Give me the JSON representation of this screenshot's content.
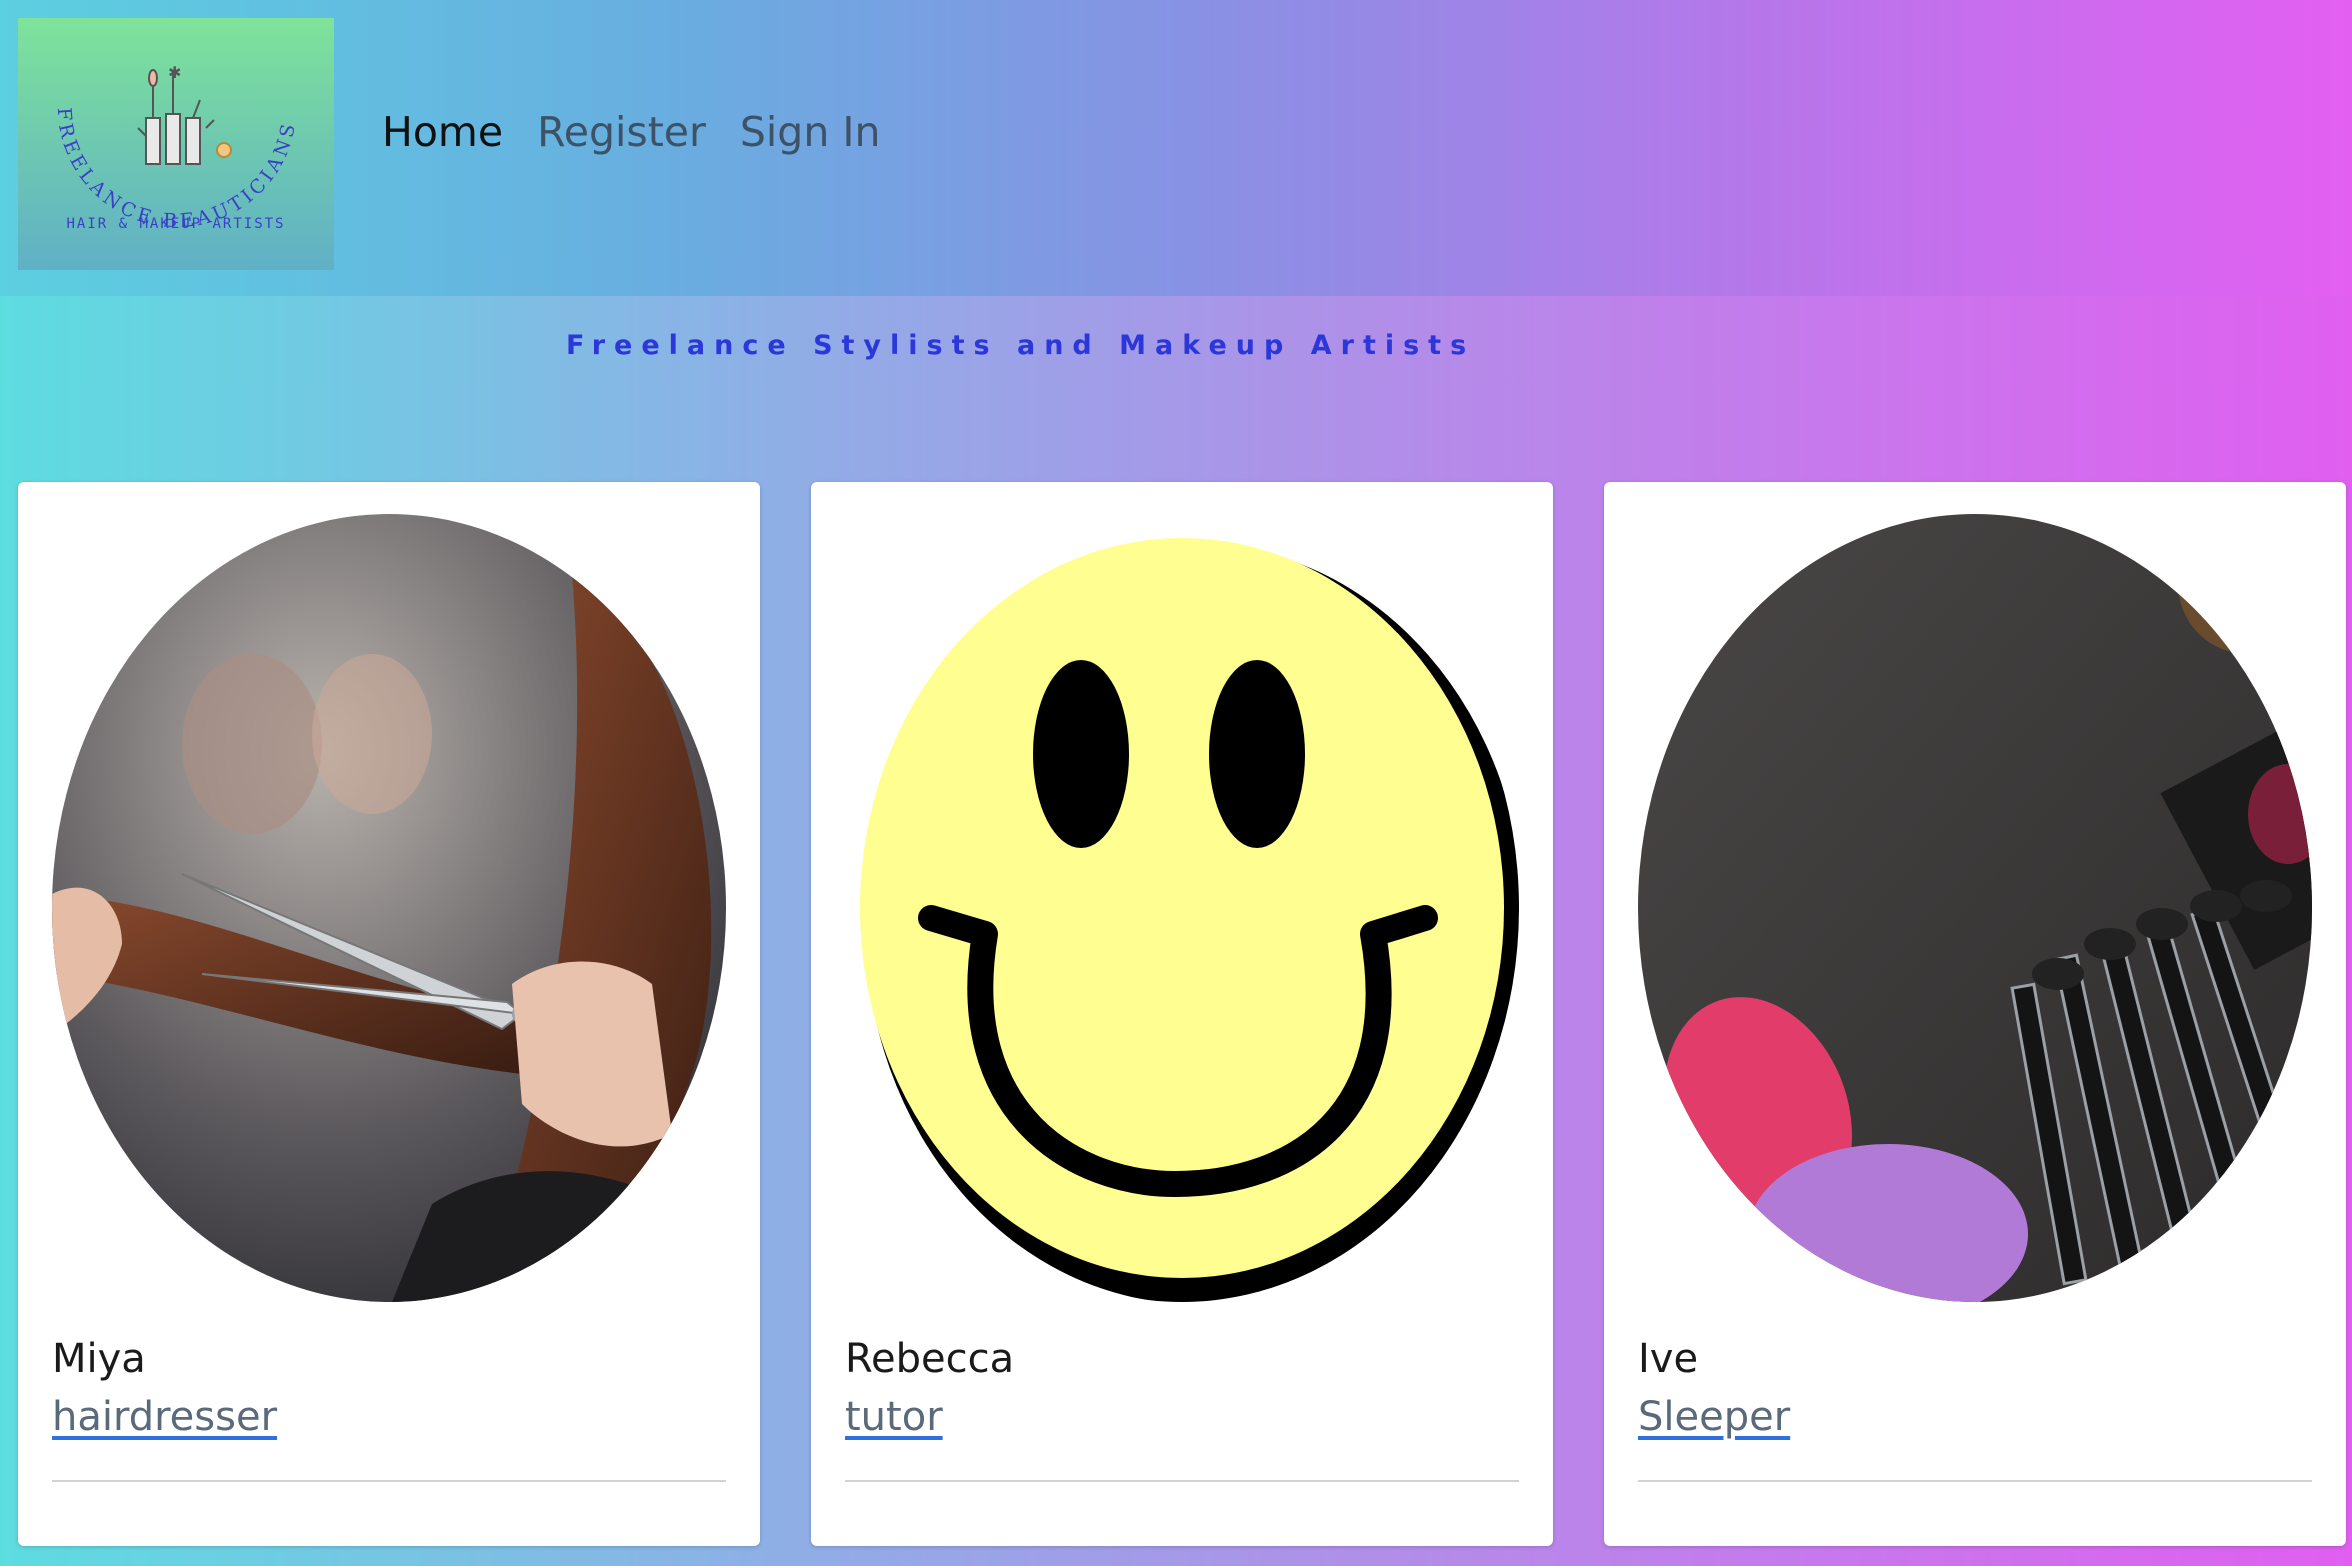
{
  "logo": {
    "arc_text": "FREELANCE BEAUTICIANS",
    "subtitle": "HAIR & MAKEUP ARTISTS"
  },
  "nav": {
    "items": [
      {
        "label": "Home",
        "active": true
      },
      {
        "label": "Register",
        "active": false
      },
      {
        "label": "Sign In",
        "active": false
      }
    ]
  },
  "tagline": "Freelance Stylists and Makeup Artists",
  "cards": [
    {
      "name": "Miya",
      "role": "hairdresser",
      "image": "scissors-cutting-hair-photo"
    },
    {
      "name": "Rebecca",
      "role": "tutor",
      "image": "smiley-face"
    },
    {
      "name": "Ive",
      "role": "Sleeper",
      "image": "makeup-brushes-photo"
    }
  ],
  "colors": {
    "tagline": "#2b37d8",
    "link_underline": "#2f6fe0",
    "gradient_start": "#5ddce0",
    "gradient_end": "#e05ff0"
  }
}
